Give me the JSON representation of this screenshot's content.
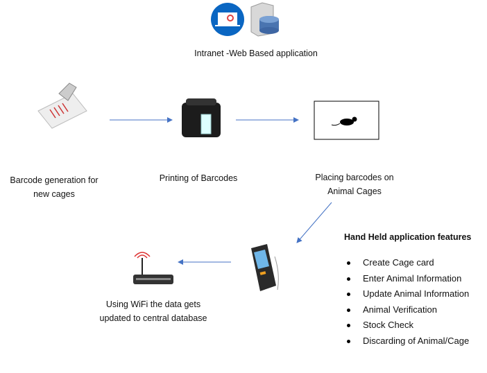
{
  "header": {
    "title": "Intranet -Web Based application",
    "icons": [
      "laptop-dashboard-icon",
      "server-database-icon"
    ]
  },
  "steps": [
    {
      "label_line1": "Barcode generation for",
      "label_line2": "new cages",
      "icon": "barcode-scanner-icon"
    },
    {
      "label_line1": "Printing of Barcodes",
      "icon": "barcode-printer-icon"
    },
    {
      "label_line1": "Placing barcodes on",
      "label_line2": "Animal Cages",
      "icon": "mouse-icon"
    },
    {
      "icon": "handheld-device-icon"
    },
    {
      "label_line1": "Using WiFi the data gets",
      "label_line2": "updated to central database",
      "icon": "wifi-router-icon"
    }
  ],
  "features": {
    "heading": "Hand Held application features",
    "items": [
      "Create Cage card",
      "Enter Animal Information",
      "Update Animal Information",
      "Animal Verification",
      "Stock Check",
      "Discarding of Animal/Cage"
    ]
  },
  "colors": {
    "arrow": "#4472c4",
    "laptop_circle": "#0a66c2"
  }
}
